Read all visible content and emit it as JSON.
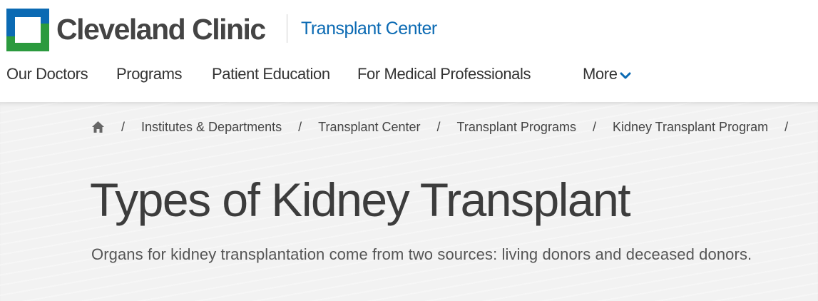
{
  "header": {
    "brand_name": "Cleveland Clinic",
    "sub_brand": "Transplant Center",
    "logo_icon": "cleveland-clinic-cross-logo",
    "colors": {
      "logo_blue": "#0b6ab3",
      "logo_green": "#2b9a3e",
      "subbrand": "#0b6ab3"
    }
  },
  "nav": {
    "items": [
      {
        "label": "Our Doctors"
      },
      {
        "label": "Programs"
      },
      {
        "label": "Patient Education"
      },
      {
        "label": "For Medical Professionals"
      }
    ],
    "more_label": "More",
    "more_icon": "chevron-down-icon"
  },
  "breadcrumb": {
    "home_icon": "home-icon",
    "separator": "/",
    "items": [
      {
        "label": "Institutes & Departments"
      },
      {
        "label": "Transplant Center"
      },
      {
        "label": "Transplant Programs"
      },
      {
        "label": "Kidney Transplant Program"
      }
    ]
  },
  "main": {
    "title": "Types of Kidney Transplant",
    "intro": "Organs for kidney transplantation come from two sources: living donors and deceased donors."
  }
}
